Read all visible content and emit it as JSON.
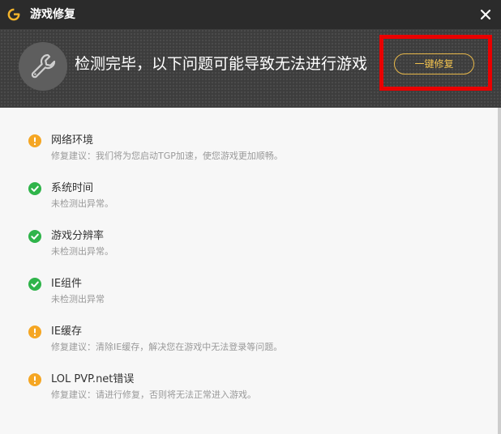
{
  "window": {
    "title": "游戏修复",
    "logo_icon": "g-logo-icon",
    "close_icon": "close-icon"
  },
  "banner": {
    "icon": "wrench-icon",
    "headline": "检测完毕，以下问题可能导致无法进行游戏",
    "fix_button_label": "一键修复"
  },
  "colors": {
    "warning": "#f5a623",
    "ok": "#2fb44a",
    "accent": "#f1c24f",
    "highlight": "#ea0000"
  },
  "items": [
    {
      "status": "warning",
      "title": "网络环境",
      "desc": "修复建议：我们将为您启动TGP加速，使您游戏更加顺畅。"
    },
    {
      "status": "ok",
      "title": "系统时间",
      "desc": "未检测出异常。"
    },
    {
      "status": "ok",
      "title": "游戏分辨率",
      "desc": "未检测出异常。"
    },
    {
      "status": "ok",
      "title": "IE组件",
      "desc": "未检测出异常"
    },
    {
      "status": "warning",
      "title": "IE缓存",
      "desc": "修复建议：清除IE缓存，解决您在游戏中无法登录等问题。"
    },
    {
      "status": "warning",
      "title": "LOL PVP.net错误",
      "desc": "修复建议：请进行修复，否则将无法正常进入游戏。"
    }
  ]
}
